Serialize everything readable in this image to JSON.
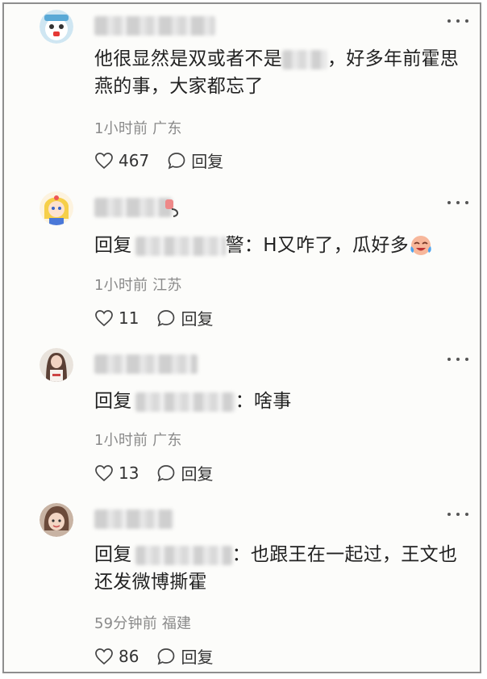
{
  "comments": [
    {
      "text_before": "他很显然是双或者不是",
      "text_after": "，好多年前霍思燕的事，大家都忘了",
      "meta": "1小时前 广东",
      "likes": "467",
      "reply_label": "回复"
    },
    {
      "reply_prefix": "回复",
      "reply_tail": "警",
      "text": "：H又咋了，瓜好多",
      "meta": "1小时前 江苏",
      "likes": "11",
      "reply_label": "回复",
      "emoji": "crying-laughing-emoji"
    },
    {
      "reply_prefix": "回复",
      "text": "：啥事",
      "meta": "1小时前 广东",
      "likes": "13",
      "reply_label": "回复"
    },
    {
      "reply_prefix": "回复",
      "text_line1": "：也跟王在一起过，王文也",
      "text_line2": "还发微博撕霍",
      "meta": "59分钟前 福建",
      "likes": "86",
      "reply_label": "回复"
    }
  ],
  "icons": {
    "more": "more-icon",
    "like": "heart-icon",
    "reply": "comment-bubble-icon"
  },
  "colors": {
    "text": "#222222",
    "meta": "#8a8a8a",
    "border": "#8e8e8e"
  }
}
